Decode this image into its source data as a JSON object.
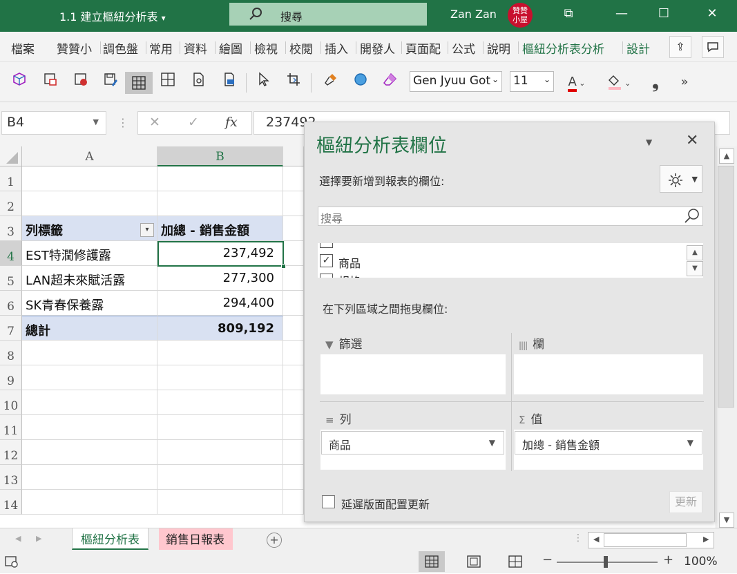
{
  "window": {
    "title": "1.1 建立樞紐分析表",
    "title_dropdown": "▾",
    "search_label": "搜尋",
    "user_name": "Zan Zan",
    "seal_text": "贊贊小屋",
    "controls": {
      "restore": "⧉",
      "minimize": "—",
      "maximize": "☐",
      "close": "✕"
    }
  },
  "menu": {
    "tabs": [
      "檔案",
      "贊贊小",
      "調色盤",
      "常用",
      "資料",
      "繪圖",
      "檢視",
      "校閱",
      "插入",
      "開發人",
      "頁面配",
      "公式",
      "說明",
      "樞紐分析表分析",
      "設計"
    ],
    "share_icon": "⇪",
    "comment_icon": "🗩"
  },
  "toolbar": {
    "font_name": "Gen Jyuu Got",
    "font_size": "11",
    "font_color_label": "A",
    "more": "»"
  },
  "formula_bar": {
    "name_box": "B4",
    "cancel": "✕",
    "enter": "✓",
    "fx": "fx",
    "value": "237492"
  },
  "grid": {
    "columns": [
      "A",
      "B"
    ],
    "rows": [
      "1",
      "2",
      "3",
      "4",
      "5",
      "6",
      "7",
      "8",
      "9",
      "10",
      "11",
      "12",
      "13",
      "14"
    ],
    "pivot": {
      "row_label_header": "列標籤",
      "value_header": "加總 - 銷售金額",
      "items": [
        {
          "label": "EST特潤修護露",
          "value": "237,492"
        },
        {
          "label": "LAN超未來賦活露",
          "value": "277,300"
        },
        {
          "label": "SK青春保養露",
          "value": "294,400"
        }
      ],
      "total_label": "總計",
      "total_value": "809,192"
    }
  },
  "pivot_pane": {
    "title": "樞紐分析表欄位",
    "close": "✕",
    "choose_label": "選擇要新增到報表的欄位:",
    "search_placeholder": "搜尋",
    "fields": [
      {
        "name": "商品",
        "checked": true,
        "mark": "✓"
      },
      {
        "name": "規格",
        "checked": false,
        "mark": ""
      }
    ],
    "drag_label": "在下列區域之間拖曳欄位:",
    "areas": {
      "filters": {
        "label": "篩選",
        "icon": "▼"
      },
      "columns": {
        "label": "欄",
        "icon": "||||"
      },
      "rows": {
        "label": "列",
        "icon": "≡",
        "field": "商品"
      },
      "values": {
        "label": "值",
        "icon": "Σ",
        "field": "加總 - 銷售金額"
      }
    },
    "defer_label": "延遲版面配置更新",
    "update_button": "更新"
  },
  "sheets": {
    "tabs": [
      "樞紐分析表",
      "銷售日報表"
    ],
    "active": "樞紐分析表",
    "add": "+"
  },
  "status": {
    "zoom_minus": "−",
    "zoom_plus": "+",
    "zoom_level": "100%"
  },
  "colors": {
    "accent": "#217346",
    "pivot_header_fill": "#d9e1f2",
    "sheet_tab_pink": "#ffc7ce"
  }
}
